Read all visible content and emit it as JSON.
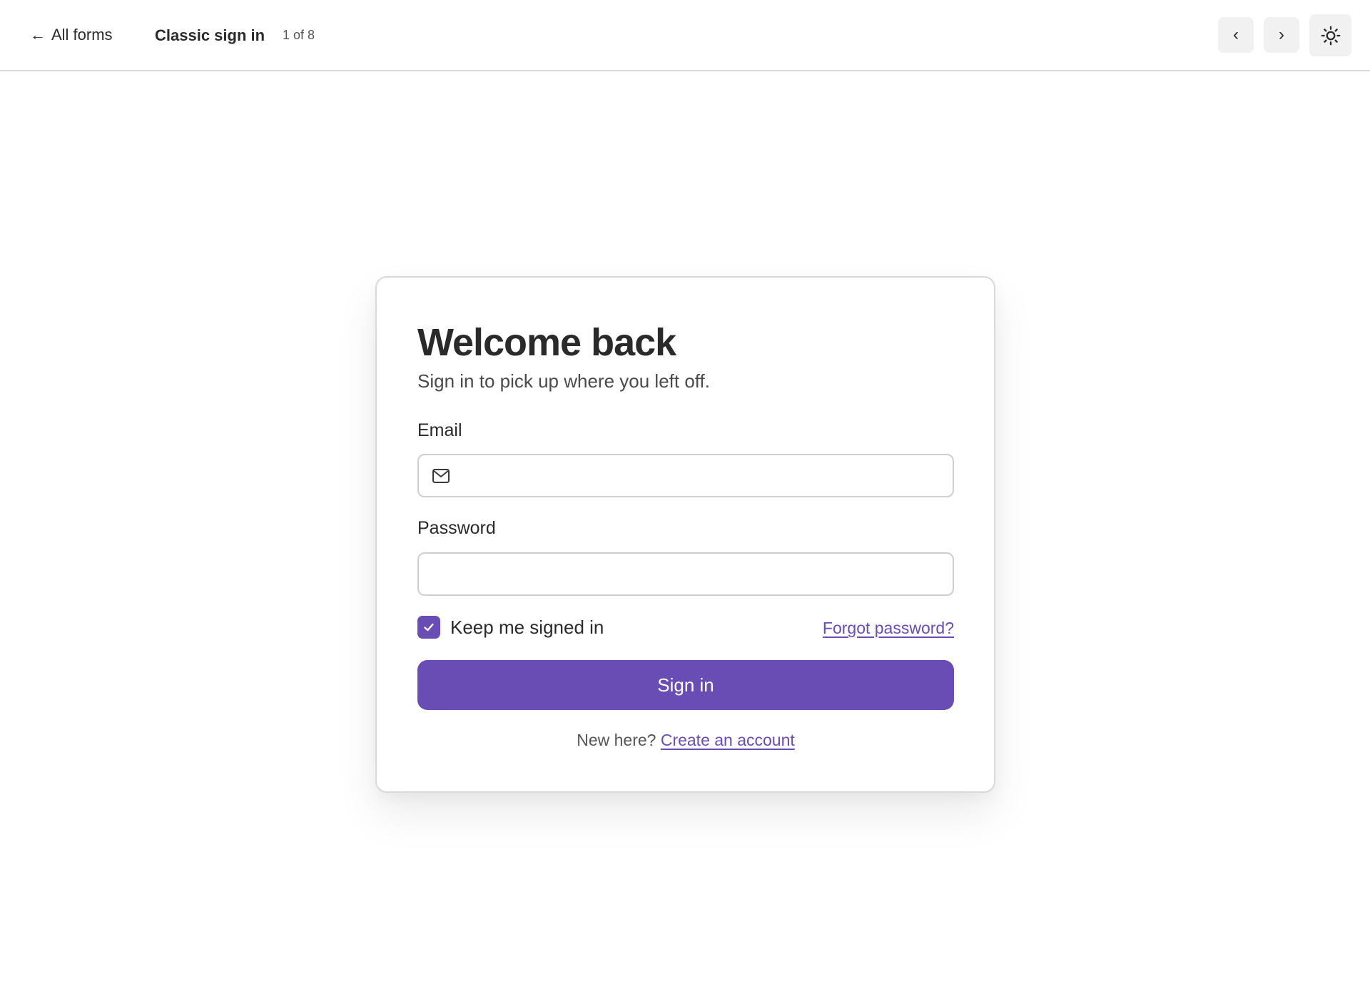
{
  "topbar": {
    "back_label": "All forms",
    "back_icon": "arrow-left-icon",
    "form_title": "Classic sign in",
    "counter": "1 of 8",
    "prev_label": "‹",
    "next_label": "›",
    "theme_icon": "sun-icon"
  },
  "card": {
    "heading": "Welcome back",
    "subheading": "Sign in to pick up where you left off.",
    "email": {
      "label": "Email",
      "value": "",
      "placeholder": "",
      "icon": "mail-icon"
    },
    "password": {
      "label": "Password",
      "value": "",
      "placeholder": ""
    },
    "remember": {
      "label": "Keep me signed in",
      "checked": true
    },
    "forgot_label": "Forgot password?",
    "submit_label": "Sign in",
    "footer_prompt": "New here?",
    "create_label": "Create an account"
  },
  "colors": {
    "accent": "#6a4cb5",
    "text": "#2a2a2a",
    "border": "#cfcfcf",
    "nav_button_bg": "#f1f1f2"
  }
}
